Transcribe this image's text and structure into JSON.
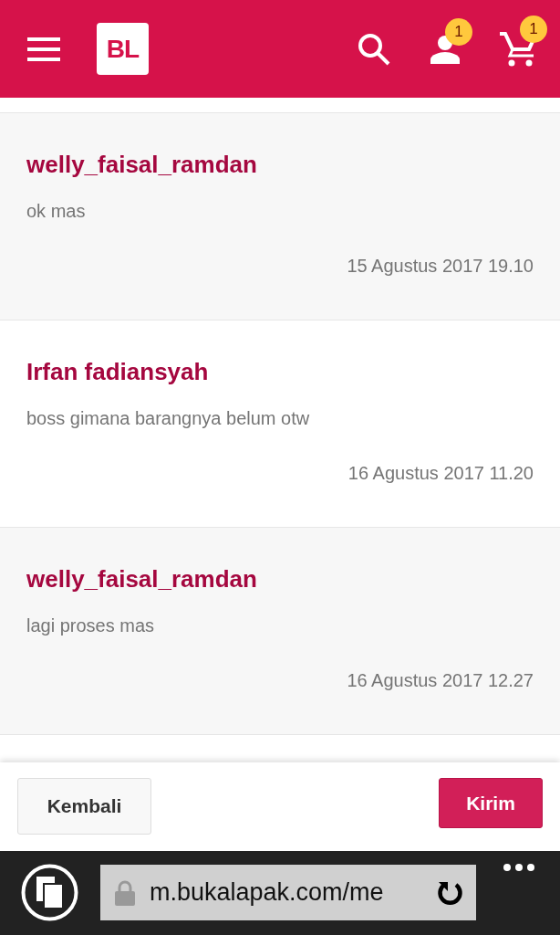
{
  "header": {
    "logo": "BL",
    "account_badge": "1",
    "cart_badge": "1"
  },
  "messages": [
    {
      "sender": "welly_faisal_ramdan",
      "text": "ok mas",
      "time": "15 Agustus 2017 19.10"
    },
    {
      "sender": "Irfan fadiansyah",
      "text": "boss gimana barangnya belum otw",
      "time": "16 Agustus 2017 11.20"
    },
    {
      "sender": "welly_faisal_ramdan",
      "text": "lagi proses mas",
      "time": "16 Agustus 2017 12.27"
    }
  ],
  "footer": {
    "back_button": "Kembali",
    "send_button": "Kirim"
  },
  "browser": {
    "url": "m.bukalapak.com/me"
  }
}
